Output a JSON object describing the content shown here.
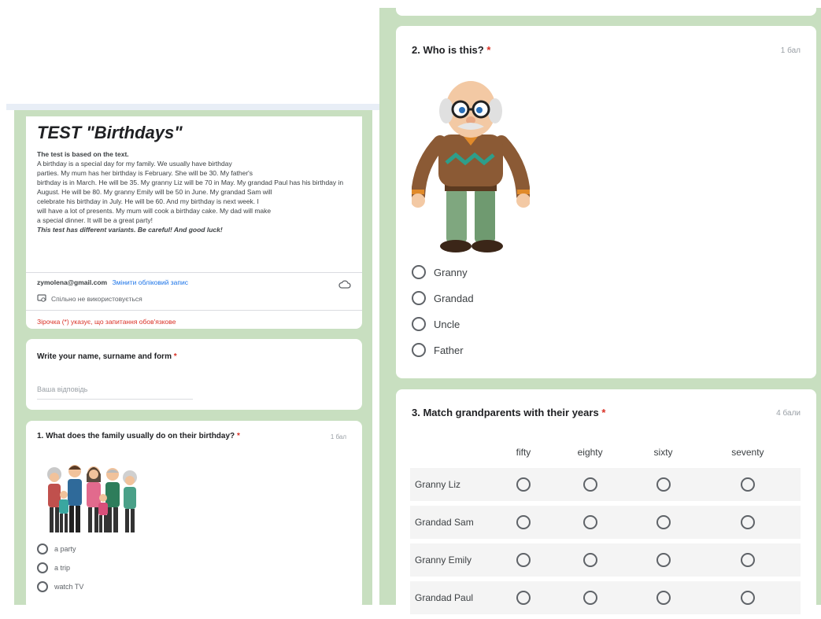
{
  "header_form": {
    "title": "TEST \"Birthdays\"",
    "intro_bold": "The test is based on the text.",
    "body_lines": [
      "A birthday is a special day for my family. We usually have birthday",
      "parties. My mum has her birthday is February. She will be 30. My father's",
      "birthday is in March. He will be 35. My granny Liz will be 70 in May. My grandad Paul has his birthday in",
      "August. He will be 80. My granny Emily will be 50 in June. My grandad Sam will",
      "celebrate his birthday in July. He will be 60. And my birthday is next week. I",
      "will have a lot of presents. My mum will cook a birthday cake. My dad will make",
      "a special dinner. It will be a great party!"
    ],
    "closing": "This test has different variants. Be careful! And good luck!",
    "email": "zymolena@gmail.com",
    "switch_account": "Змінити обліковий запис",
    "not_shared": "Спільно не використовується",
    "required_note": "Зірочка (*) указує, що запитання обов'язкове"
  },
  "name_question": {
    "title": "Write your name, surname and form",
    "placeholder": "Ваша відповідь"
  },
  "q1": {
    "title": "1. What does the family usually do on their birthday?",
    "points": "1 бал",
    "options": [
      "a party",
      "a trip",
      "watch TV"
    ]
  },
  "q2": {
    "title": "2. Who is this?",
    "points": "1 бал",
    "options": [
      "Granny",
      "Grandad",
      "Uncle",
      "Father"
    ]
  },
  "q3": {
    "title": "3. Match grandparents with their years",
    "points": "4 бали",
    "columns": [
      "fifty",
      "eighty",
      "sixty",
      "seventy"
    ],
    "rows": [
      "Granny Liz",
      "Grandad Sam",
      "Granny Emily",
      "Grandad Paul"
    ]
  },
  "asterisk": "*",
  "colors": {
    "background_green": "#c8dfc0",
    "required_red": "#d93025",
    "link_blue": "#1a73e8"
  },
  "icons": [
    "cloud-icon",
    "not-shared-icon"
  ]
}
